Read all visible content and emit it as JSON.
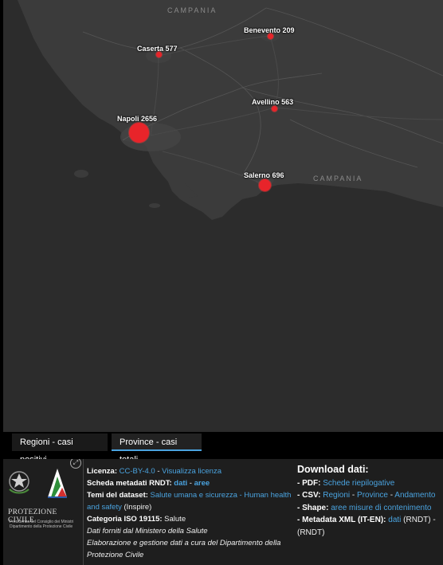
{
  "map": {
    "region_labels": [
      "CAMPANIA",
      "CAMPANIA"
    ],
    "cities": [
      {
        "name": "Benevento 209"
      },
      {
        "name": "Caserta 577"
      },
      {
        "name": "Avellino 563"
      },
      {
        "name": "Napoli 2656"
      },
      {
        "name": "Salerno 696"
      }
    ],
    "colors": {
      "land": "#3a3a3a",
      "sea": "#2c2c2c",
      "border": "#555555",
      "dot": "#e8242a"
    }
  },
  "tabs": {
    "regioni": "Regioni - casi positivi",
    "province": "Province - casi totali"
  },
  "footer": {
    "logo": {
      "brand": "PROTEZIONE CIVILE",
      "sub1": "Presidenza del Consiglio dei Ministri",
      "sub2": "Dipartimento della Protezione Civile"
    },
    "meta": {
      "licenza_label": "Licenza:",
      "licenza_link": "CC-BY-4.0",
      "sep1": " - ",
      "licenza_link2": "Visualizza licenza",
      "scheda_label": "Scheda metadati RNDT:",
      "scheda_link1": "dati",
      "sep2": " - ",
      "scheda_link2": "aree",
      "temi_label": "Temi del dataset:",
      "temi_link": "Salute umana e sicurezza - Human health and safety",
      "temi_extra": "(Inspire)",
      "cat_label": "Categoria ISO 19115:",
      "cat_value": "Salute",
      "note1": "Dati forniti dal Ministero della Salute",
      "note2": "Elaborazione e gestione dati a cura del Dipartimento della Protezione Civile"
    },
    "download": {
      "title": "Download dati:",
      "pdf_label": "- PDF:",
      "pdf_link": "Schede riepilogative",
      "csv_label": "- CSV:",
      "csv_links": [
        "Regioni",
        "Province",
        "Andamento"
      ],
      "csv_sep": " - ",
      "shape_label": "- Shape:",
      "shape_link": "aree misure di contenimento",
      "xml_label": "- Metadata XML (IT-EN):",
      "xml_link": "dati",
      "xml_extra": "(RNDT) -",
      "xml_extra2": "(RNDT)"
    }
  }
}
